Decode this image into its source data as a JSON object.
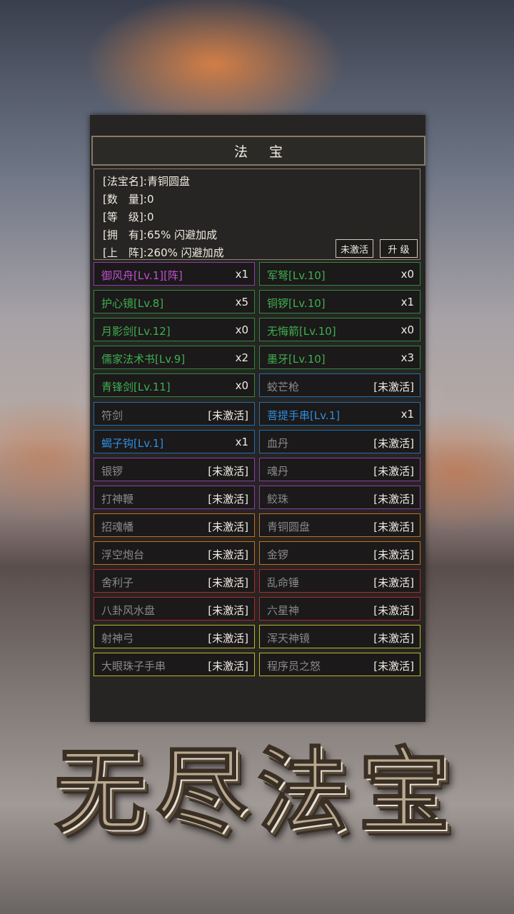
{
  "panel": {
    "title": "法 宝",
    "info": {
      "rows": [
        {
          "key": "[法宝名]:",
          "value": "青铜圆盘"
        },
        {
          "key": "[数　量]:",
          "value": "0"
        },
        {
          "key": "[等　级]:",
          "value": "0"
        },
        {
          "key": "[拥　有]:",
          "value": "65% 闪避加成"
        },
        {
          "key": "[上　阵]:",
          "value": "260% 闪避加成"
        }
      ],
      "status_button": "未激活",
      "upgrade_button": "升 级"
    }
  },
  "items": [
    {
      "name": "御风舟[Lv.1][阵]",
      "count": "x1",
      "name_color": "#c24fd6",
      "border_color": "#8e3ca8"
    },
    {
      "name": "军弩[Lv.10]",
      "count": "x0",
      "name_color": "#3fae4f",
      "border_color": "#2f8a3c"
    },
    {
      "name": "护心镜[Lv.8]",
      "count": "x5",
      "name_color": "#3fae4f",
      "border_color": "#2f8a3c"
    },
    {
      "name": "铜锣[Lv.10]",
      "count": "x1",
      "name_color": "#3fae4f",
      "border_color": "#2f8a3c"
    },
    {
      "name": "月影剑[Lv.12]",
      "count": "x0",
      "name_color": "#3fae4f",
      "border_color": "#2f8a3c"
    },
    {
      "name": "无悔箭[Lv.10]",
      "count": "x0",
      "name_color": "#3fae4f",
      "border_color": "#2f8a3c"
    },
    {
      "name": "儒家法术书[Lv.9]",
      "count": "x2",
      "name_color": "#3fae4f",
      "border_color": "#2f8a3c"
    },
    {
      "name": "墨牙[Lv.10]",
      "count": "x3",
      "name_color": "#3fae4f",
      "border_color": "#2f8a3c"
    },
    {
      "name": "青锋剑[Lv.11]",
      "count": "x0",
      "name_color": "#3fae4f",
      "border_color": "#2f8a3c"
    },
    {
      "name": "蛟芒枪",
      "count": "[未激活]",
      "name_color": "#8a8a8a",
      "border_color": "#1f6fb0"
    },
    {
      "name": "符剑",
      "count": "[未激活]",
      "name_color": "#8a8a8a",
      "border_color": "#1f6fb0"
    },
    {
      "name": "菩提手串[Lv.1]",
      "count": "x1",
      "name_color": "#2f8ee0",
      "border_color": "#1f6fb0"
    },
    {
      "name": "蝎子钩[Lv.1]",
      "count": "x1",
      "name_color": "#2f8ee0",
      "border_color": "#1f6fb0"
    },
    {
      "name": "血丹",
      "count": "[未激活]",
      "name_color": "#8a8a8a",
      "border_color": "#1f6fb0"
    },
    {
      "name": "银锣",
      "count": "[未激活]",
      "name_color": "#8a8a8a",
      "border_color": "#8e3ca8"
    },
    {
      "name": "魂丹",
      "count": "[未激活]",
      "name_color": "#8a8a8a",
      "border_color": "#8e3ca8"
    },
    {
      "name": "打神鞭",
      "count": "[未激活]",
      "name_color": "#8a8a8a",
      "border_color": "#8e3ca8"
    },
    {
      "name": "鲛珠",
      "count": "[未激活]",
      "name_color": "#8a8a8a",
      "border_color": "#8e3ca8"
    },
    {
      "name": "招魂幡",
      "count": "[未激活]",
      "name_color": "#8a8a8a",
      "border_color": "#c0701c"
    },
    {
      "name": "青铜圆盘",
      "count": "[未激活]",
      "name_color": "#8a8a8a",
      "border_color": "#c0701c"
    },
    {
      "name": "浮空炮台",
      "count": "[未激活]",
      "name_color": "#8a8a8a",
      "border_color": "#c0701c"
    },
    {
      "name": "金锣",
      "count": "[未激活]",
      "name_color": "#8a8a8a",
      "border_color": "#c0701c"
    },
    {
      "name": "舍利子",
      "count": "[未激活]",
      "name_color": "#8a8a8a",
      "border_color": "#b02a2a"
    },
    {
      "name": "乱命锤",
      "count": "[未激活]",
      "name_color": "#8a8a8a",
      "border_color": "#b02a2a"
    },
    {
      "name": "八卦风水盘",
      "count": "[未激活]",
      "name_color": "#8a8a8a",
      "border_color": "#b02a2a"
    },
    {
      "name": "六星神",
      "count": "[未激活]",
      "name_color": "#8a8a8a",
      "border_color": "#b02a2a"
    },
    {
      "name": "射神弓",
      "count": "[未激活]",
      "name_color": "#8a8a8a",
      "border_color": "#b8b82a"
    },
    {
      "name": "浑天神镜",
      "count": "[未激活]",
      "name_color": "#8a8a8a",
      "border_color": "#b8b82a"
    },
    {
      "name": "大眼珠子手串",
      "count": "[未激活]",
      "name_color": "#8a8a8a",
      "border_color": "#b8b82a"
    },
    {
      "name": "程序员之怒",
      "count": "[未激活]",
      "name_color": "#8a8a8a",
      "border_color": "#b8b82a"
    }
  ],
  "game_title": "无尽法宝"
}
